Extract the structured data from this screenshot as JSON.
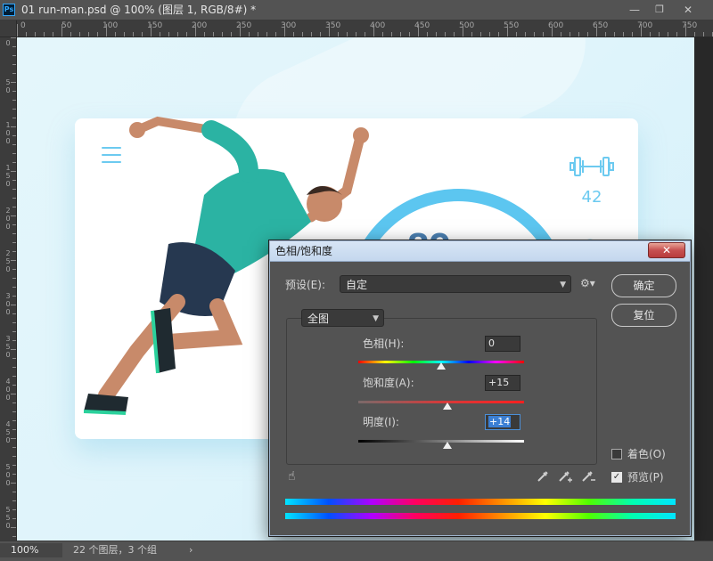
{
  "app": {
    "logo_text": "Ps",
    "document_title": "01 run-man.psd @ 100% (图层 1, RGB/8#) *",
    "window_buttons": {
      "minimize": "—",
      "restore": "❐",
      "close": "✕"
    }
  },
  "rulers": {
    "top_labels": [
      "0",
      "50",
      "100",
      "150",
      "200",
      "250",
      "300",
      "350",
      "400",
      "450",
      "500",
      "550",
      "600",
      "650",
      "700",
      "750"
    ],
    "left_labels": [
      "0",
      "50",
      "100",
      "150",
      "200",
      "250",
      "300",
      "350",
      "400",
      "450",
      "500",
      "550"
    ]
  },
  "canvas": {
    "stat_count": "42",
    "ring_number": "89",
    "colors": {
      "accent": "#5cc6f0",
      "card": "#ffffff",
      "background": "#e4f6fb",
      "shirt": "#2bb3a3",
      "shorts": "#263850"
    }
  },
  "dialog": {
    "title": "色相/饱和度",
    "close_label": "✕",
    "preset_label": "预设(E):",
    "preset_value": "自定",
    "ok_label": "确定",
    "cancel_label": "复位",
    "channel_value": "全图",
    "hue": {
      "label": "色相(H):",
      "value": "0",
      "level": 0.5
    },
    "saturation": {
      "label": "饱和度(A):",
      "value": "+15",
      "level": 0.54
    },
    "lightness": {
      "label": "明度(I):",
      "value": "+14",
      "level": 0.54
    },
    "colorize": {
      "label": "着色(O)",
      "checked": false
    },
    "preview": {
      "label": "预览(P)",
      "checked": true
    }
  },
  "status": {
    "zoom": "100%",
    "layers_info": "22 个图层，3 个组",
    "arrow": "›"
  }
}
